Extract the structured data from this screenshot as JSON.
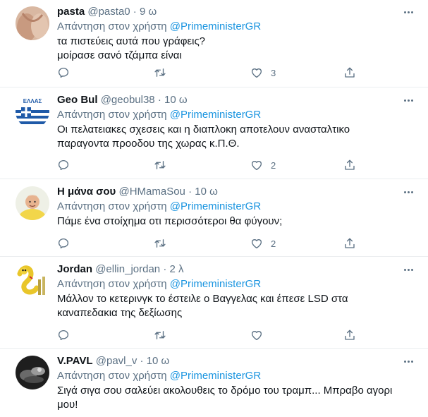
{
  "replying_prefix": "Απάντηση στον χρήστη",
  "mention": "@PrimeministerGR",
  "tweets": [
    {
      "name": "pasta",
      "handle": "@pasta0",
      "time": "9 ω",
      "lines": [
        "τα πιστεύεις αυτά που γράφεις?",
        "μοίρασε σανό τζάμπα είναι"
      ],
      "likes": "3"
    },
    {
      "name": "Geo Bul",
      "handle": "@geobul38",
      "time": "10 ω",
      "lines": [
        "Οι πελατειακες σχεσεις και η διαπλοκη αποτελουν ανασταλτικο",
        "παραγοντα προοδου της χωρας κ.Π.Θ."
      ],
      "likes": "2",
      "avatar_text": "ΕΛΛΑΣ"
    },
    {
      "name": "Η μάνα σου",
      "handle": "@HMamaSou",
      "time": "10 ω",
      "lines": [
        "Πάμε ένα στοίχημα οτι περισσότεροι θα φύγουν;"
      ],
      "likes": "2"
    },
    {
      "name": "Jordan",
      "handle": "@ellin_jordan",
      "time": "2 λ",
      "lines": [
        "Μάλλον το κετερινγκ το έστειλε ο Βαγγελας και έπεσε LSD στα",
        "καναπεδακια της δεξίωσης"
      ],
      "likes": ""
    },
    {
      "name": "V.PAVL",
      "handle": "@pavl_v",
      "time": "10 ω",
      "lines": [
        "Σιγά σιγα σου σαλεύει ακολουθεις το δρόμο του τραμπ... Μπραβο αγορι",
        "μου!"
      ],
      "likes": ""
    }
  ],
  "icons": {
    "reply": "reply-icon",
    "retweet": "retweet-icon",
    "like": "heart-icon",
    "share": "share-icon",
    "more": "more-options-icon"
  },
  "colors": {
    "text": "#0f1419",
    "secondary": "#5b7083",
    "link": "#1b95e0",
    "divider": "#ebeef0"
  }
}
